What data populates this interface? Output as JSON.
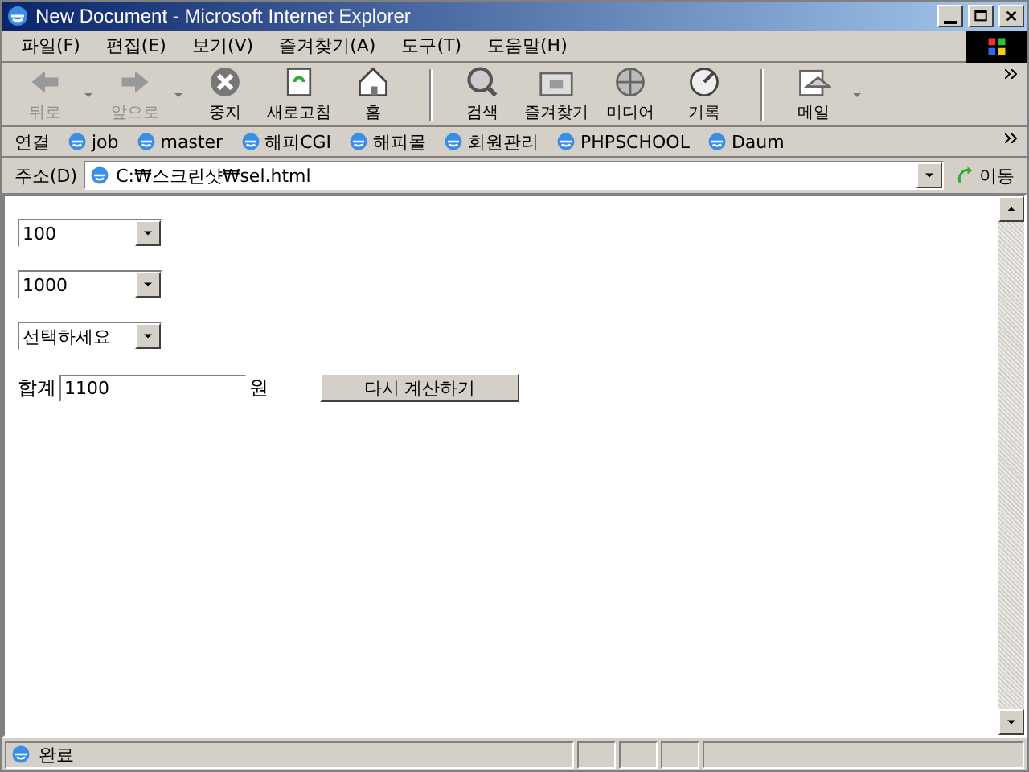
{
  "window": {
    "title": "New Document - Microsoft Internet Explorer"
  },
  "menu": [
    "파일(F)",
    "편집(E)",
    "보기(V)",
    "즐겨찾기(A)",
    "도구(T)",
    "도움말(H)"
  ],
  "toolbar": [
    {
      "label": "뒤로",
      "kind": "back",
      "disabled": true,
      "dropdown": true
    },
    {
      "label": "앞으로",
      "kind": "forward",
      "disabled": true,
      "dropdown": true
    },
    {
      "label": "중지",
      "kind": "stop",
      "disabled": false,
      "dropdown": false
    },
    {
      "label": "새로고침",
      "kind": "refresh",
      "disabled": false,
      "dropdown": false
    },
    {
      "label": "홈",
      "kind": "home",
      "disabled": false,
      "dropdown": false
    },
    {
      "label": "검색",
      "kind": "search",
      "disabled": false,
      "dropdown": false
    },
    {
      "label": "즐겨찾기",
      "kind": "favorites",
      "disabled": false,
      "dropdown": false
    },
    {
      "label": "미디어",
      "kind": "media",
      "disabled": false,
      "dropdown": false
    },
    {
      "label": "기록",
      "kind": "history",
      "disabled": false,
      "dropdown": false
    },
    {
      "label": "메일",
      "kind": "mail",
      "disabled": false,
      "dropdown": true
    }
  ],
  "links": {
    "label": "연결",
    "items": [
      "job",
      "master",
      "해피CGI",
      "해피몰",
      "회원관리",
      "PHPSCHOOL",
      "Daum"
    ]
  },
  "address": {
    "label": "주소(D)",
    "value": "C:₩스크린샷₩sel.html",
    "go": "이동"
  },
  "page": {
    "selects": [
      "100",
      "1000",
      "선택하세요"
    ],
    "total_label": "합계",
    "total_value": "1100",
    "unit": "원",
    "button": "다시 계산하기"
  },
  "status_bar": {
    "text": "완료"
  }
}
